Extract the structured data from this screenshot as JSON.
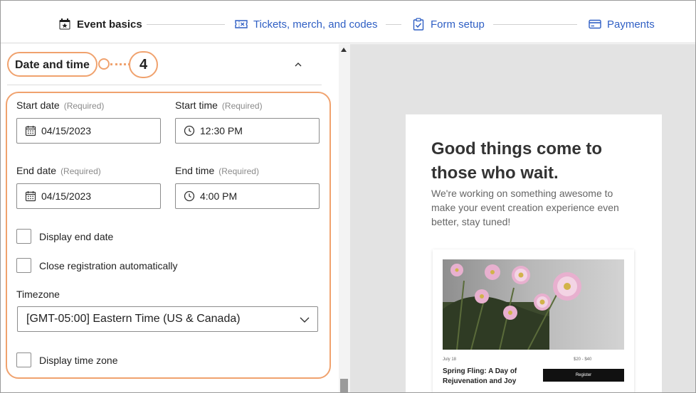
{
  "nav": {
    "steps": [
      {
        "label": "Event basics",
        "icon": "calendar-star-icon",
        "state": "active"
      },
      {
        "label": "Tickets, merch, and codes",
        "icon": "ticket-icon",
        "state": "link"
      },
      {
        "label": "Form setup",
        "icon": "clipboard-check-icon",
        "state": "link"
      },
      {
        "label": "Payments",
        "icon": "credit-card-icon",
        "state": "link"
      }
    ]
  },
  "section": {
    "title": "Date and time",
    "callout_number": "4",
    "collapse_icon": "chevron-up-icon"
  },
  "form": {
    "start_date": {
      "label": "Start date",
      "required": "(Required)",
      "value": "04/15/2023"
    },
    "start_time": {
      "label": "Start time",
      "required": "(Required)",
      "value": "12:30 PM"
    },
    "end_date": {
      "label": "End date",
      "required": "(Required)",
      "value": "04/15/2023"
    },
    "end_time": {
      "label": "End time",
      "required": "(Required)",
      "value": "4:00 PM"
    },
    "display_end_date": {
      "label": "Display end date",
      "checked": false
    },
    "close_registration": {
      "label": "Close registration automatically",
      "checked": false
    },
    "timezone": {
      "label": "Timezone",
      "value": "[GMT-05:00] Eastern Time (US & Canada)"
    },
    "display_time_zone": {
      "label": "Display time zone",
      "checked": false
    }
  },
  "preview": {
    "headline": "Good things come to those who wait.",
    "subtext": "We're working on something awesome to make your event creation experience even better, stay tuned!",
    "card": {
      "date": "July 18",
      "price": "$20 - $40",
      "title": "Spring Fling: A Day of Rejuvenation and Joy",
      "button": "Register"
    }
  },
  "colors": {
    "accent_link": "#2f5fc4",
    "callout_orange": "#f0a26e",
    "preview_bg": "#e3e3e3"
  }
}
